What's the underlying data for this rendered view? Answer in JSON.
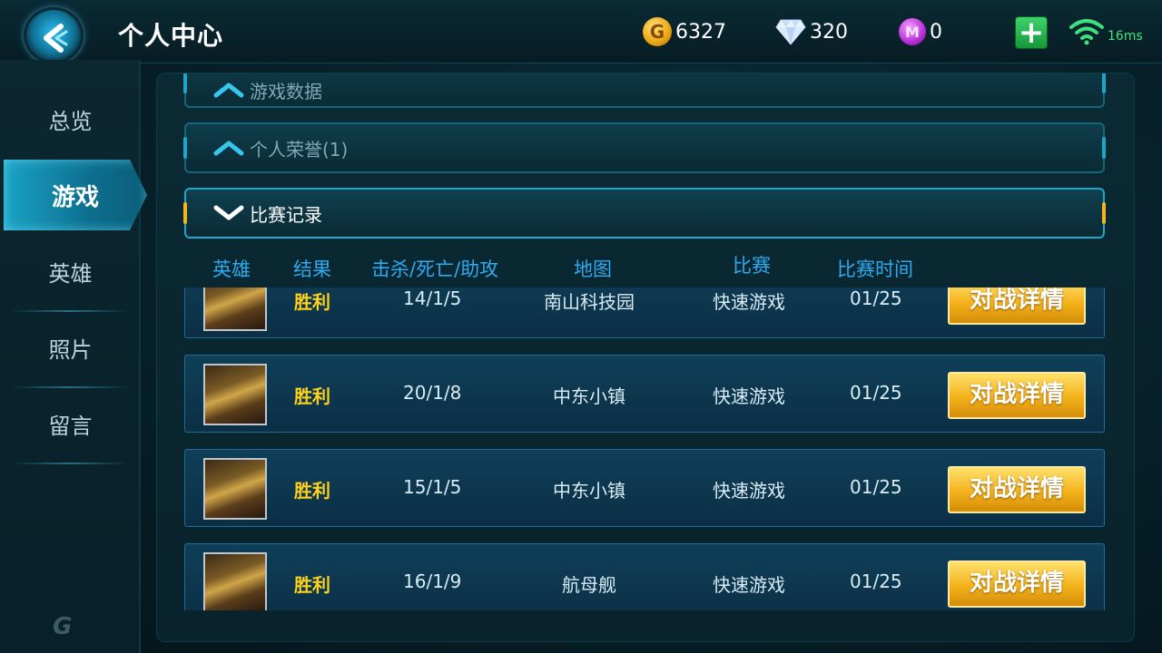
{
  "header": {
    "title": "个人中心",
    "gold": "6327",
    "diamond": "320",
    "gem": "0",
    "ping": "16ms",
    "icons": [
      "back-arrow-icon",
      "gold-coin-icon",
      "diamond-icon",
      "purple-gem-icon",
      "plus-icon",
      "wifi-icon"
    ]
  },
  "sidebar": {
    "items": [
      {
        "label": "总览"
      },
      {
        "label": "游戏"
      },
      {
        "label": "英雄"
      },
      {
        "label": "照片"
      },
      {
        "label": "留言"
      }
    ],
    "active_index": 1
  },
  "sections": {
    "game_data": "游戏数据",
    "honors": "个人荣誉(1)",
    "records": "比赛记录"
  },
  "columns": {
    "hero": "英雄",
    "result": "结果",
    "kda": "击杀/死亡/助攻",
    "map": "地图",
    "mode": "比赛",
    "time": "比赛时间"
  },
  "records": [
    {
      "result": "胜利",
      "kda": "14/1/5",
      "map": "南山科技园",
      "mode": "快速游戏",
      "time": "01/25",
      "action": "对战详情"
    },
    {
      "result": "胜利",
      "kda": "20/1/8",
      "map": "中东小镇",
      "mode": "快速游戏",
      "time": "01/25",
      "action": "对战详情"
    },
    {
      "result": "胜利",
      "kda": "15/1/5",
      "map": "中东小镇",
      "mode": "快速游戏",
      "time": "01/25",
      "action": "对战详情"
    },
    {
      "result": "胜利",
      "kda": "16/1/9",
      "map": "航母舰",
      "mode": "快速游戏",
      "time": "01/25",
      "action": "对战详情"
    }
  ],
  "colors": {
    "accent": "#1aa3c6",
    "win": "#ffd21a",
    "column_header": "#2fa9ef",
    "button": "#f3b21b"
  }
}
